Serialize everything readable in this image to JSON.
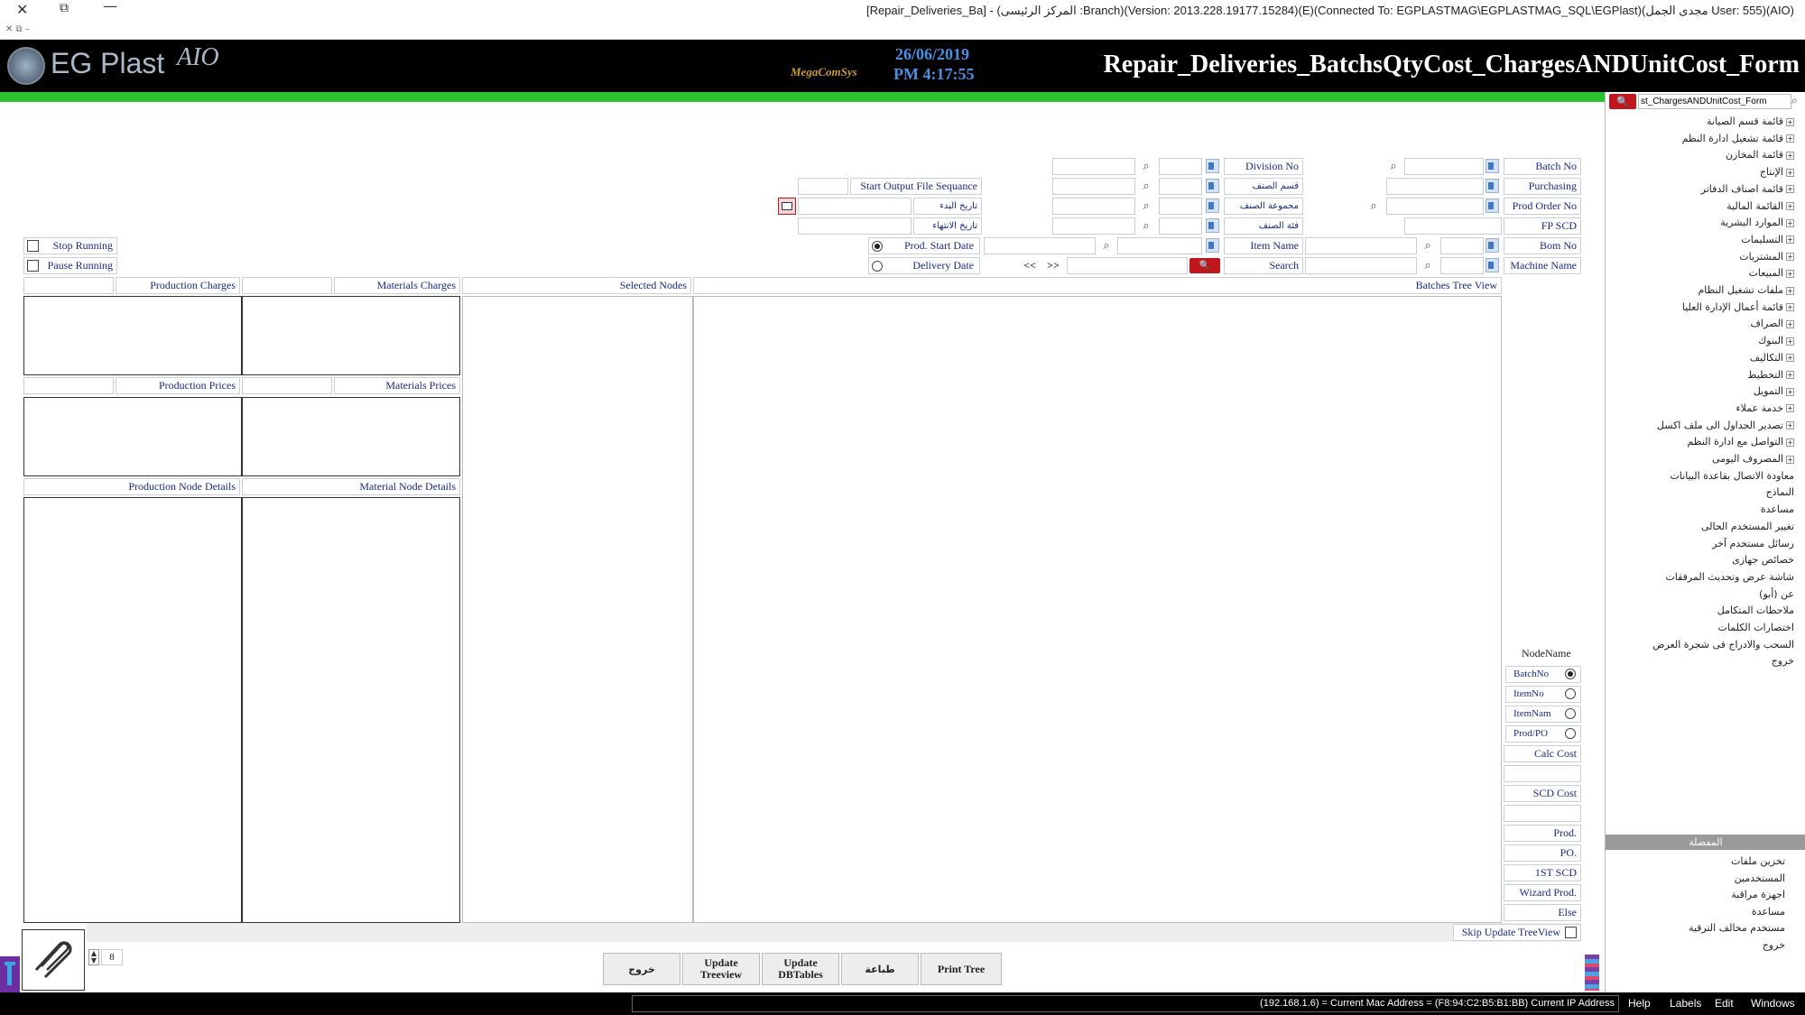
{
  "titlebar": {
    "text": "[Repair_Deliveries_Ba] - (المركز الرئيسى :Branch)(Version: 2013.228.19177.15284)(E)(Connected To: EGPLASTMAG\\EGPLASTMAG_SQL\\EGPlast)(مجدى الجمل User: 555)(AIO)"
  },
  "header": {
    "logo": "EG Plast",
    "logo_suffix": "AIO",
    "brand": "MegaComSys",
    "date": "26/06/2019",
    "time": "PM 4:17:55",
    "form_title": "Repair_Deliveries_BatchsQtyCost_ChargesANDUnitCost_Form"
  },
  "side_search": {
    "value": "st_ChargesANDUnitCost_Form"
  },
  "fields": {
    "batch_no": "Batch No",
    "purchasing": "Purchasing",
    "prod_order_no": "Prod Order No",
    "fp_scd": "FP SCD",
    "bom_no": "Bom No",
    "machine_name": "Machine Name",
    "division_no": "Division No",
    "item_section": "قسم الصنف",
    "item_group": "مجموعة الصنف",
    "item_category": "فئة الصنف",
    "item_name": "Item Name",
    "search": "Search",
    "start_output": "Start Output File Sequance",
    "start_date": "تاريخ البدء",
    "end_date": "تاريخ الانتهاء",
    "prod_start_date": "Prod. Start Date",
    "delivery_date": "Delivery Date",
    "prev": "<<",
    "next": ">>"
  },
  "controls": {
    "stop_running": "Stop Running",
    "pause_running": "Pause Running"
  },
  "panels": {
    "production_charges": "Production Charges",
    "materials_charges": "Materials Charges",
    "selected_nodes": "Selected Nodes",
    "batches_tree": "Batches Tree View",
    "production_prices": "Production Prices",
    "materials_prices": "Materials Prices",
    "production_node_details": "Production Node Details",
    "material_node_details": "Material Node Details"
  },
  "nodename": {
    "title": "NodeName",
    "options": [
      "BatchNo",
      "ItemNo",
      "ItemNam",
      "Prod/PO"
    ],
    "selected": "BatchNo"
  },
  "right_buttons": [
    "Calc Cost",
    "SCD Cost",
    "Prod.",
    "PO.",
    "1ST SCD",
    "Wizard Prod.",
    "Else"
  ],
  "skip_update": "Skip Update TreeView",
  "bottom_buttons": [
    "خروج",
    "Update Treeview",
    "Update DBTables",
    "طباعة",
    "Print Tree"
  ],
  "page_num": "8",
  "tree_menu": [
    "قائمة قسم الصيانة",
    "قائمة تشغيل ادارة النظم",
    "قائمة المخازن",
    "الإنتاج",
    "قائمة اصناف الدفاتر",
    "القائمة المالية",
    "الموارد البشرية",
    "التسليمات",
    "المشتريات",
    "المبيعات",
    "ملفات تشغيل النظام",
    "قائمة أعمال الإدارة العليا",
    "الصراف",
    "البنوك",
    "التكاليف",
    "التخطيط",
    "التمويل",
    "خدمة عملاء",
    "تصدير الجداول الى ملف اكسل",
    "التواصل مع ادارة النظم",
    "المصروف اليومى",
    "معاودة الاتصال بقاعدة البيانات",
    "النماذج",
    "مساعدة",
    "تغيير المستخدم الحالى",
    "رسائل مستخدم آخر",
    "خصائص جهازى",
    "شاشة عرض وتحديث المرفقات",
    "عن (أبو)",
    "ملاحظات المتكامل",
    "اختصارات الكلمات",
    "السحب والادراج فى شجرة العرض",
    "خروج"
  ],
  "favorites": {
    "title": "المفضلة",
    "items": [
      "تخزين ملفات",
      "المستخدمين",
      "اجهزة مراقبة",
      "مساعدة",
      "مستخدم مخالف الترقية",
      "خروج"
    ]
  },
  "statusbar": {
    "info": "(192.168.1.6) = Current Mac Address = (F8:94:C2:B5:B1:BB) Current IP Address",
    "menus": [
      "Help",
      "Labels",
      "Edit",
      "Windows"
    ]
  }
}
